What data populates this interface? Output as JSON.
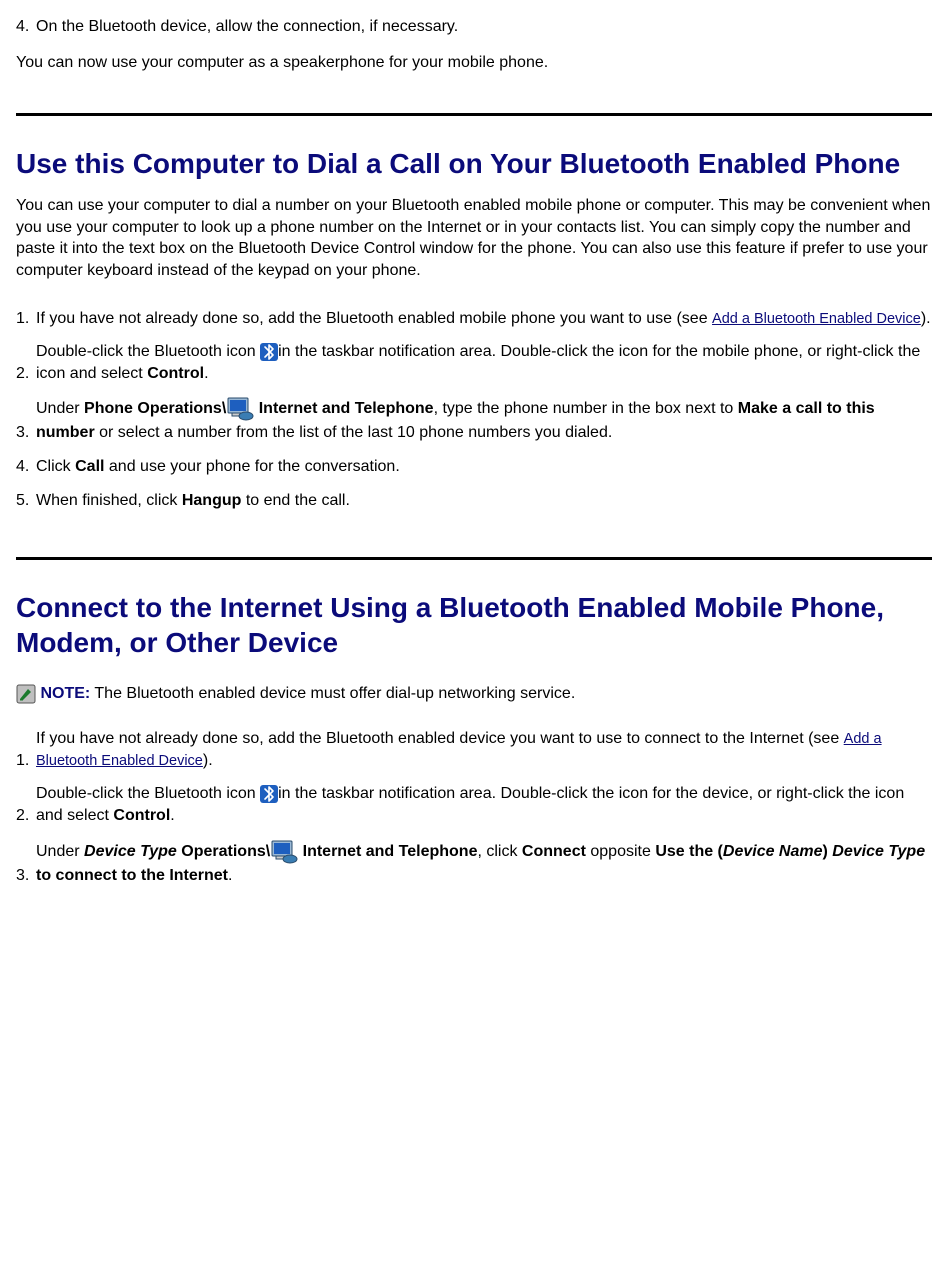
{
  "intro": {
    "step4": "On the Bluetooth device, allow the connection, if necessary.",
    "step4_num": "4.",
    "para_after": "You can now use your computer as a speakerphone for your mobile phone."
  },
  "dial": {
    "heading": "Use this Computer to Dial a Call on Your Bluetooth Enabled Phone",
    "intro": "You can use your computer to dial a number on your Bluetooth enabled mobile phone or computer. This may be convenient when you use your computer to look up a phone number on the Internet or in your contacts list. You can simply copy the number and paste it into the text box on the Bluetooth Device Control window for the phone. You can also use this feature if prefer to use your computer keyboard instead of the keypad on your phone.",
    "step1_num": "1.",
    "step1_pre": "If you have not already done so, add the Bluetooth enabled mobile phone you want to use (see ",
    "step1_link": "Add a Bluetooth Enabled Device",
    "step1_post": ").",
    "step2_num": "2.",
    "step2_a": "Double-click the Bluetooth icon ",
    "step2_b": "in the taskbar notification area. Double-click the icon for the mobile phone, or right-click the icon and select ",
    "step2_c": "Control",
    "step2_d": ".",
    "step3_num": "3.",
    "step3_a": "Under ",
    "step3_b": "Phone Operations\\",
    "step3_c": " Internet and Telephone",
    "step3_d": ", type the phone number in the box next to ",
    "step3_e": "Make a call to this number",
    "step3_f": " or select a number from the list of the last 10 phone numbers you dialed.",
    "step4_num": "4.",
    "step4_a": "Click ",
    "step4_b": "Call",
    "step4_c": " and use your phone for the conversation.",
    "step5_num": "5.",
    "step5_a": "When finished, click ",
    "step5_b": "Hangup",
    "step5_c": " to end the call."
  },
  "connect": {
    "heading": "Connect to the Internet Using a Bluetooth Enabled Mobile Phone, Modem, or Other Device",
    "note_label": "NOTE:",
    "note_text": " The Bluetooth enabled device must offer dial-up networking service.",
    "step1_num": "1.",
    "step1_pre": "If you have not already done so, add the Bluetooth enabled device you want to use to connect to the Internet (see ",
    "step1_link": "Add a Bluetooth Enabled Device",
    "step1_post": ").",
    "step2_num": "2.",
    "step2_a": "Double-click the Bluetooth icon ",
    "step2_b": "in the taskbar notification area. Double-click the icon for the device, or right-click the icon and select ",
    "step2_c": "Control",
    "step2_d": ".",
    "step3_num": "3.",
    "step3_a": "Under ",
    "step3_b": "Device Type",
    "step3_c": " Operations\\",
    "step3_d": " Internet and Telephone",
    "step3_e": ", click ",
    "step3_f": "Connect",
    "step3_g": " opposite ",
    "step3_h": "Use the (",
    "step3_i": "Device Name",
    "step3_j": ") ",
    "step3_k": "Device Type",
    "step3_l": " to connect to the Internet",
    "step3_m": "."
  }
}
